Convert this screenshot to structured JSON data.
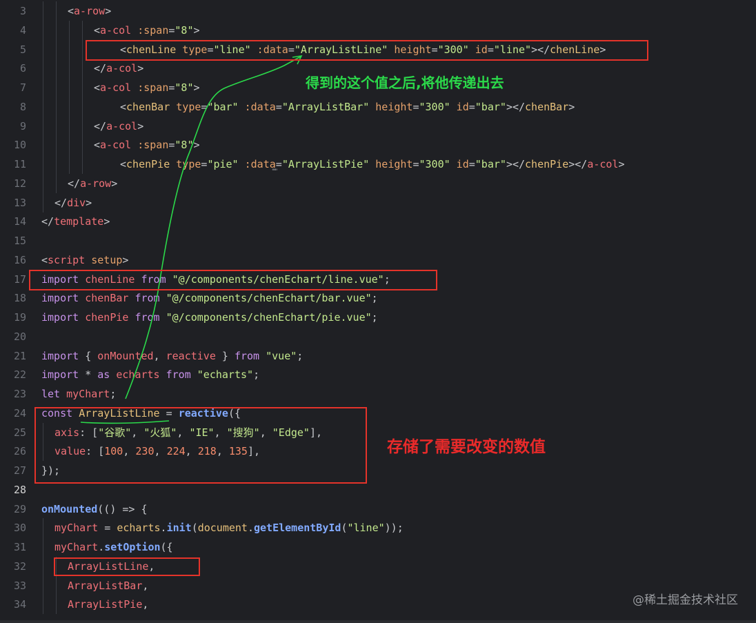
{
  "editor": {
    "lines": [
      {
        "n": "3",
        "indent": 1,
        "tokens": [
          [
            "<",
            "punc"
          ],
          [
            "a-row",
            "tag"
          ],
          [
            ">",
            "punc"
          ]
        ]
      },
      {
        "n": "4",
        "indent": 2,
        "tokens": [
          [
            "<",
            "punc"
          ],
          [
            "a-col",
            "tag"
          ],
          [
            " :span",
            "attr"
          ],
          [
            "=",
            "punc"
          ],
          [
            "\"8\"",
            "str"
          ],
          [
            ">",
            "punc"
          ]
        ]
      },
      {
        "n": "5",
        "indent": 3,
        "tokens": [
          [
            "<",
            "punc"
          ],
          [
            "chenLine",
            "comp"
          ],
          [
            " type",
            "attr"
          ],
          [
            "=",
            "punc"
          ],
          [
            "\"line\"",
            "str"
          ],
          [
            " :data",
            "attr"
          ],
          [
            "=",
            "punc"
          ],
          [
            "\"ArrayListLine\"",
            "str"
          ],
          [
            " height",
            "attr"
          ],
          [
            "=",
            "punc"
          ],
          [
            "\"300\"",
            "str"
          ],
          [
            " id",
            "attr"
          ],
          [
            "=",
            "punc"
          ],
          [
            "\"line\"",
            "str"
          ],
          [
            "></",
            "punc"
          ],
          [
            "chenLine",
            "comp"
          ],
          [
            ">",
            "punc"
          ]
        ]
      },
      {
        "n": "6",
        "indent": 2,
        "tokens": [
          [
            "</",
            "punc"
          ],
          [
            "a-col",
            "tag"
          ],
          [
            ">",
            "punc"
          ]
        ]
      },
      {
        "n": "7",
        "indent": 2,
        "tokens": [
          [
            "<",
            "punc"
          ],
          [
            "a-col",
            "tag"
          ],
          [
            " :span",
            "attr"
          ],
          [
            "=",
            "punc"
          ],
          [
            "\"8\"",
            "str"
          ],
          [
            ">",
            "punc"
          ]
        ]
      },
      {
        "n": "8",
        "indent": 3,
        "tokens": [
          [
            "<",
            "punc"
          ],
          [
            "chenBar",
            "comp"
          ],
          [
            " type",
            "attr"
          ],
          [
            "=",
            "punc"
          ],
          [
            "\"bar\"",
            "str"
          ],
          [
            " :data",
            "attr"
          ],
          [
            "=",
            "punc"
          ],
          [
            "\"ArrayListBar\"",
            "str"
          ],
          [
            " height",
            "attr"
          ],
          [
            "=",
            "punc"
          ],
          [
            "\"300\"",
            "str"
          ],
          [
            " id",
            "attr"
          ],
          [
            "=",
            "punc"
          ],
          [
            "\"bar\"",
            "str"
          ],
          [
            "></",
            "punc"
          ],
          [
            "chenBar",
            "comp"
          ],
          [
            ">",
            "punc"
          ]
        ]
      },
      {
        "n": "9",
        "indent": 2,
        "tokens": [
          [
            "</",
            "punc"
          ],
          [
            "a-col",
            "tag"
          ],
          [
            ">",
            "punc"
          ]
        ]
      },
      {
        "n": "10",
        "indent": 2,
        "tokens": [
          [
            "<",
            "punc"
          ],
          [
            "a-col",
            "tag"
          ],
          [
            " :span",
            "attr"
          ],
          [
            "=",
            "punc"
          ],
          [
            "\"8\"",
            "str"
          ],
          [
            ">",
            "punc"
          ]
        ]
      },
      {
        "n": "11",
        "indent": 3,
        "tokens": [
          [
            "<",
            "punc"
          ],
          [
            "chenPie",
            "comp"
          ],
          [
            " type",
            "attr"
          ],
          [
            "=",
            "punc"
          ],
          [
            "\"pie\"",
            "str"
          ],
          [
            " :data",
            "attr"
          ],
          [
            "=",
            "punc"
          ],
          [
            "\"ArrayListPie\"",
            "str"
          ],
          [
            " height",
            "attr"
          ],
          [
            "=",
            "punc"
          ],
          [
            "\"300\"",
            "str"
          ],
          [
            " id",
            "attr"
          ],
          [
            "=",
            "punc"
          ],
          [
            "\"bar\"",
            "str"
          ],
          [
            "></",
            "punc"
          ],
          [
            "chenPie",
            "comp"
          ],
          [
            "></",
            "punc"
          ],
          [
            "a-col",
            "tag"
          ],
          [
            ">",
            "punc"
          ]
        ]
      },
      {
        "n": "12",
        "indent": 1,
        "tokens": [
          [
            "</",
            "punc"
          ],
          [
            "a-row",
            "tag"
          ],
          [
            ">",
            "punc"
          ]
        ]
      },
      {
        "n": "13",
        "indent": 0.5,
        "tokens": [
          [
            "</",
            "punc"
          ],
          [
            "div",
            "tag"
          ],
          [
            ">",
            "punc"
          ]
        ]
      },
      {
        "n": "14",
        "indent": 0,
        "tokens": [
          [
            "</",
            "punc"
          ],
          [
            "template",
            "tag"
          ],
          [
            ">",
            "punc"
          ]
        ]
      },
      {
        "n": "15",
        "indent": 0,
        "tokens": []
      },
      {
        "n": "16",
        "indent": 0,
        "tokens": [
          [
            "<",
            "punc"
          ],
          [
            "script",
            "tag"
          ],
          [
            " setup",
            "attr"
          ],
          [
            ">",
            "punc"
          ]
        ]
      },
      {
        "n": "17",
        "indent": 0,
        "tokens": [
          [
            "import",
            "kw"
          ],
          [
            " chenLine ",
            "var"
          ],
          [
            "from",
            "kw"
          ],
          [
            " \"@/components/chenEchart/line.vue\"",
            "str"
          ],
          [
            ";",
            "punc"
          ]
        ]
      },
      {
        "n": "18",
        "indent": 0,
        "tokens": [
          [
            "import",
            "kw"
          ],
          [
            " chenBar ",
            "var"
          ],
          [
            "from",
            "kw"
          ],
          [
            " \"@/components/chenEchart/bar.vue\"",
            "str"
          ],
          [
            ";",
            "punc"
          ]
        ]
      },
      {
        "n": "19",
        "indent": 0,
        "tokens": [
          [
            "import",
            "kw"
          ],
          [
            " chenPie ",
            "var"
          ],
          [
            "from",
            "kw"
          ],
          [
            " \"@/components/chenEchart/pie.vue\"",
            "str"
          ],
          [
            ";",
            "punc"
          ]
        ]
      },
      {
        "n": "20",
        "indent": 0,
        "tokens": []
      },
      {
        "n": "21",
        "indent": 0,
        "tokens": [
          [
            "import",
            "kw"
          ],
          [
            " { ",
            "punc"
          ],
          [
            "onMounted",
            "var"
          ],
          [
            ", ",
            "punc"
          ],
          [
            "reactive",
            "var"
          ],
          [
            " } ",
            "punc"
          ],
          [
            "from",
            "kw"
          ],
          [
            " \"vue\"",
            "str"
          ],
          [
            ";",
            "punc"
          ]
        ]
      },
      {
        "n": "22",
        "indent": 0,
        "tokens": [
          [
            "import",
            "kw"
          ],
          [
            " * ",
            "punc"
          ],
          [
            "as",
            "kw"
          ],
          [
            " echarts ",
            "var"
          ],
          [
            "from",
            "kw"
          ],
          [
            " \"echarts\"",
            "str"
          ],
          [
            ";",
            "punc"
          ]
        ]
      },
      {
        "n": "23",
        "indent": 0,
        "tokens": [
          [
            "let",
            "kw"
          ],
          [
            " myChart",
            "var"
          ],
          [
            ";",
            "punc"
          ]
        ]
      },
      {
        "n": "24",
        "indent": 0,
        "tokens": [
          [
            "const",
            "kw"
          ],
          [
            " ",
            "plain"
          ],
          [
            "ArrayListLine",
            "comp"
          ],
          [
            " = ",
            "punc"
          ],
          [
            "reactive",
            "fn"
          ],
          [
            "({",
            "punc"
          ]
        ]
      },
      {
        "n": "25",
        "indent": 0.5,
        "tokens": [
          [
            "axis",
            "var"
          ],
          [
            ": [",
            "punc"
          ],
          [
            "\"谷歌\"",
            "str"
          ],
          [
            ", ",
            "punc"
          ],
          [
            "\"火狐\"",
            "str"
          ],
          [
            ", ",
            "punc"
          ],
          [
            "\"IE\"",
            "str"
          ],
          [
            ", ",
            "punc"
          ],
          [
            "\"搜狗\"",
            "str"
          ],
          [
            ", ",
            "punc"
          ],
          [
            "\"Edge\"",
            "str"
          ],
          [
            "],",
            "punc"
          ]
        ]
      },
      {
        "n": "26",
        "indent": 0.5,
        "tokens": [
          [
            "value",
            "var"
          ],
          [
            ": [",
            "punc"
          ],
          [
            "100",
            "num"
          ],
          [
            ", ",
            "punc"
          ],
          [
            "230",
            "num"
          ],
          [
            ", ",
            "punc"
          ],
          [
            "224",
            "num"
          ],
          [
            ", ",
            "punc"
          ],
          [
            "218",
            "num"
          ],
          [
            ", ",
            "punc"
          ],
          [
            "135",
            "num"
          ],
          [
            "],",
            "punc"
          ]
        ]
      },
      {
        "n": "27",
        "indent": 0,
        "tokens": [
          [
            "});",
            "punc"
          ]
        ]
      },
      {
        "n": "28",
        "indent": 0,
        "tokens": []
      },
      {
        "n": "29",
        "indent": 0,
        "tokens": [
          [
            "onMounted",
            "fn"
          ],
          [
            "(() => {",
            "punc"
          ]
        ]
      },
      {
        "n": "30",
        "indent": 0.5,
        "tokens": [
          [
            "myChart",
            "var"
          ],
          [
            " = ",
            "punc"
          ],
          [
            "echarts",
            "comp"
          ],
          [
            ".",
            "punc"
          ],
          [
            "init",
            "fn"
          ],
          [
            "(",
            "punc"
          ],
          [
            "document",
            "comp"
          ],
          [
            ".",
            "punc"
          ],
          [
            "getElementById",
            "fn"
          ],
          [
            "(",
            "punc"
          ],
          [
            "\"line\"",
            "str"
          ],
          [
            "));",
            "punc"
          ]
        ]
      },
      {
        "n": "31",
        "indent": 0.5,
        "tokens": [
          [
            "myChart",
            "var"
          ],
          [
            ".",
            "punc"
          ],
          [
            "setOption",
            "fn"
          ],
          [
            "({",
            "punc"
          ]
        ]
      },
      {
        "n": "32",
        "indent": 1,
        "tokens": [
          [
            "ArrayListLine",
            "var"
          ],
          [
            ",",
            "punc"
          ]
        ]
      },
      {
        "n": "33",
        "indent": 1,
        "tokens": [
          [
            "ArrayListBar",
            "var"
          ],
          [
            ",",
            "punc"
          ]
        ]
      },
      {
        "n": "34",
        "indent": 1,
        "tokens": [
          [
            "ArrayListPie",
            "var"
          ],
          [
            ",",
            "punc"
          ]
        ]
      }
    ],
    "active_line": "28"
  },
  "annotations": {
    "green_note": "得到的这个值之后,将他传递出去",
    "red_note": "存储了需要改变的数值",
    "ellipsis_mark": "\"\"\"",
    "arrow_color": "#2bd94a",
    "box_color": "#e5332a"
  },
  "watermark": "@稀土掘金技术社区"
}
